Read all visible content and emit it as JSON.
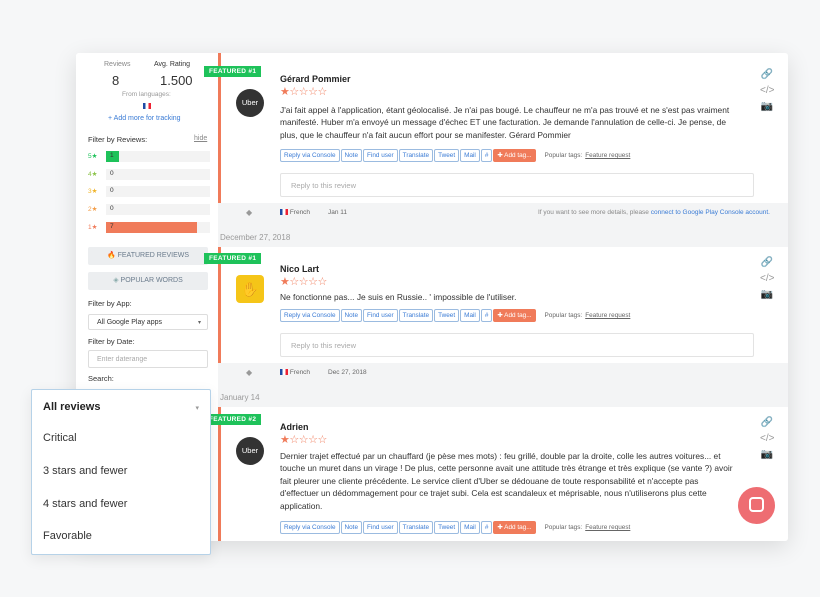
{
  "sidebar": {
    "reviews_label": "Reviews",
    "reviews_value": "8",
    "avg_label": "Avg. Rating",
    "avg_value": "1.500",
    "from_languages": "From languages:",
    "add_more": "+ Add more for tracking",
    "filter_reviews": "Filter by Reviews:",
    "hide": "hide",
    "ratings": [
      {
        "label": "5★",
        "count": "1",
        "color": "#1ec25a",
        "fill_fraction": 0.125
      },
      {
        "label": "4★",
        "count": "0",
        "color": "#8bc34a",
        "fill_fraction": 0
      },
      {
        "label": "3★",
        "count": "0",
        "color": "#f0b429",
        "fill_fraction": 0
      },
      {
        "label": "2★",
        "count": "0",
        "color": "#f39c46",
        "fill_fraction": 0
      },
      {
        "label": "1★",
        "count": "7",
        "color": "#f07b5a",
        "fill_fraction": 0.875
      }
    ],
    "featured_reviews": "FEATURED REVIEWS",
    "popular_words": "POPULAR WORDS",
    "filter_app": "Filter by App:",
    "app_value": "All Google Play apps",
    "filter_date": "Filter by Date:",
    "date_placeholder": "Enter daterange",
    "search": "Search:"
  },
  "dropdown": {
    "selected": "All reviews",
    "options": [
      "Critical",
      "3 stars and fewer",
      "4 stars and fewer",
      "Favorable"
    ]
  },
  "actions": {
    "reply_console": "Reply via Console",
    "note": "Note",
    "find_user": "Find user",
    "translate": "Translate",
    "tweet": "Tweet",
    "mail": "Mail",
    "hash": "#",
    "add_tag": "✚ Add tag...",
    "popular_tags": "Popular tags:",
    "feature_request": "Feature request",
    "reply_placeholder": "Reply to this review"
  },
  "reviews": [
    {
      "badge": "FEATURED #1",
      "avatar": "Uber",
      "name": "Gérard Pommier",
      "stars": "★☆☆☆☆",
      "text": "J'ai fait appel à l'application, étant géolocalisé. Je n'ai pas bougé. Le chauffeur ne m'a pas trouvé et ne s'est pas vraiment manifesté. Huber m'a envoyé un message d'échec ET une facturation. Je demande l'annulation de celle-ci. Je pense, de plus, que le chauffeur n'a fait aucun effort pour se manifester. Gérard Pommier",
      "lang": "French",
      "date": "Jan 11",
      "note_prefix": "If you want to see more details, please",
      "note_link": "connect to Google Play Console account."
    },
    {
      "badge": "FEATURED #1",
      "avatar": "✋",
      "name": "Nico Lart",
      "stars": "★☆☆☆☆",
      "text": "Ne fonctionne pas... Je suis en Russie.. ' impossible de l'utiliser.",
      "lang": "French",
      "date": "Dec 27, 2018"
    },
    {
      "badge": "FEATURED #2",
      "avatar": "Uber",
      "name": "Adrien",
      "stars": "★☆☆☆☆",
      "text": "Dernier trajet effectué par un chauffard (je pèse mes mots) : feu grillé, double par la droite, colle les autres voitures... et touche un muret dans un virage ! De plus, cette personne avait une attitude très étrange et très explique (se vante ?) avoir fait pleurer une cliente précédente. Le service client d'Uber se dédouane de toute responsabilité et n'accepte pas d'effectuer un dédommagement pour ce trajet subi. Cela est scandaleux et méprisable, nous n'utiliserons plus cette application."
    }
  ],
  "section_dates": [
    "December 27, 2018",
    "January 14"
  ]
}
